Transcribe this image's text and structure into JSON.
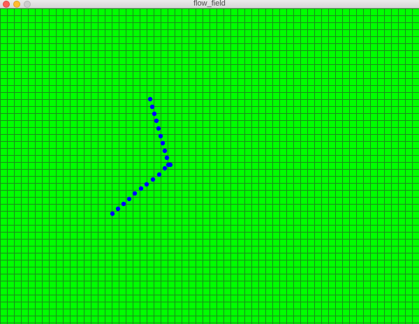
{
  "window": {
    "title": "flow_field"
  },
  "colors": {
    "field_background": "#00ff00",
    "grid_line": "#1a8a1a",
    "particle": "#0000ff"
  },
  "icons": [
    "close-icon",
    "minimize-icon",
    "zoom-icon"
  ]
}
